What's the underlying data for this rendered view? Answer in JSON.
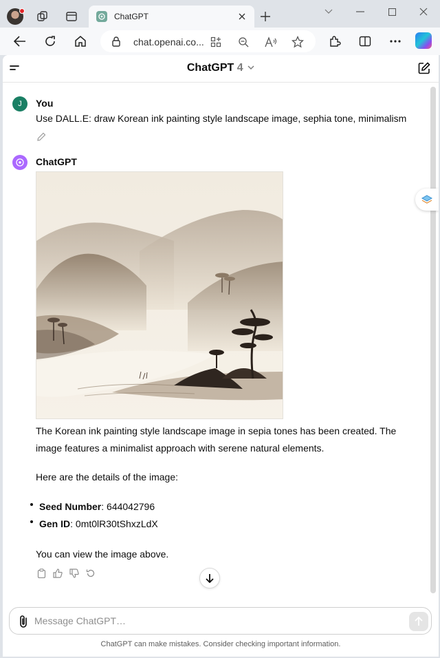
{
  "browser": {
    "tab_title": "ChatGPT",
    "url": "chat.openai.co..."
  },
  "app": {
    "model_name": "ChatGPT",
    "model_version": "4"
  },
  "conversation": {
    "user": {
      "author": "You",
      "avatar_letter": "J",
      "text": "Use DALL.E: draw Korean ink painting style landscape image, sephia tone, minimalism"
    },
    "assistant": {
      "author": "ChatGPT",
      "paragraph1_line1": "The Korean ink painting style landscape image in sepia tones has been created. The",
      "paragraph1_line2": "image features a minimalist approach with serene natural elements.",
      "paragraph2": "Here are the details of the image:",
      "details": [
        {
          "label": "Seed Number",
          "value": ": 644042796"
        },
        {
          "label": "Gen ID",
          "value": ": 0mt0lR30tShxzLdX"
        }
      ],
      "paragraph3": "You can view the image above."
    }
  },
  "composer": {
    "placeholder": "Message ChatGPT…"
  },
  "footer": "ChatGPT can make mistakes. Consider checking important information.",
  "colors": {
    "user_avatar": "#1a7f64",
    "assistant_avatar": "#ab68ff",
    "sepia_light": "#f3ece0",
    "sepia_ink": "#3b2f27"
  }
}
